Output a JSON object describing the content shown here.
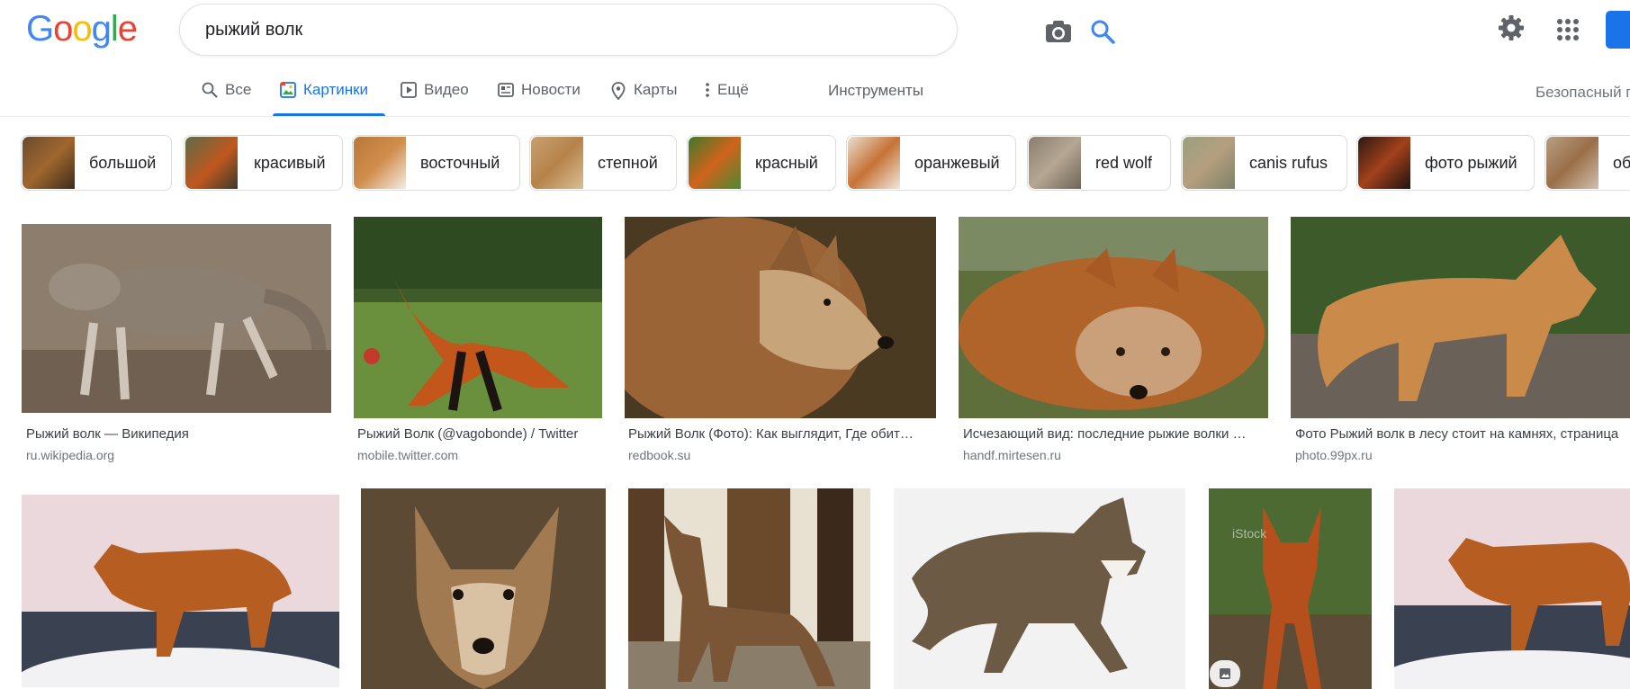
{
  "app": {
    "logo_letters": [
      "G",
      "o",
      "o",
      "g",
      "l",
      "e"
    ]
  },
  "search": {
    "query": "рыжий волк"
  },
  "colors": {
    "accent": "#1a73e8",
    "logo": [
      "#4285f4",
      "#ea4335",
      "#fbbc05",
      "#4285f4",
      "#34a853",
      "#ea4335"
    ]
  },
  "nav": {
    "tabs": [
      {
        "label": "Все",
        "icon": "search-icon"
      },
      {
        "label": "Картинки",
        "icon": "image-icon"
      },
      {
        "label": "Видео",
        "icon": "video-icon"
      },
      {
        "label": "Новости",
        "icon": "news-icon"
      },
      {
        "label": "Карты",
        "icon": "map-pin-icon"
      },
      {
        "label": "Ещё",
        "icon": "more-vert-icon"
      }
    ],
    "active_tab": "Картинки",
    "tools": "Инструменты",
    "safesearch": "Безопасный п"
  },
  "chips": [
    {
      "label": "большой"
    },
    {
      "label": "красивый"
    },
    {
      "label": "восточный"
    },
    {
      "label": "степной"
    },
    {
      "label": "красный"
    },
    {
      "label": "оранжевый"
    },
    {
      "label": "red wolf"
    },
    {
      "label": "canis rufus"
    },
    {
      "label": "фото рыжий"
    },
    {
      "label": "об"
    }
  ],
  "results_row1": [
    {
      "title": "Рыжий волк — Википедия",
      "domain": "ru.wikipedia.org"
    },
    {
      "title": "Рыжий Волк (@vagobonde) / Twitter",
      "domain": "mobile.twitter.com"
    },
    {
      "title": "Рыжий Волк (Фото): Как выглядит, Где обит…",
      "domain": "redbook.su"
    },
    {
      "title": "Исчезающий вид: последние рыжие волки …",
      "domain": "handf.mirtesen.ru"
    },
    {
      "title": "Фото Рыжий волк в лесу стоит на камнях, страница",
      "domain": "photo.99px.ru"
    }
  ],
  "results_row2": [
    {
      "alt": "wolf-on-snow"
    },
    {
      "alt": "coyote-portrait"
    },
    {
      "alt": "red-wolf-in-forest"
    },
    {
      "alt": "wolf-walking-snow"
    },
    {
      "alt": "maned-wolf-istock",
      "watermark": "iStock"
    },
    {
      "alt": "wolf-on-snow-2"
    }
  ]
}
